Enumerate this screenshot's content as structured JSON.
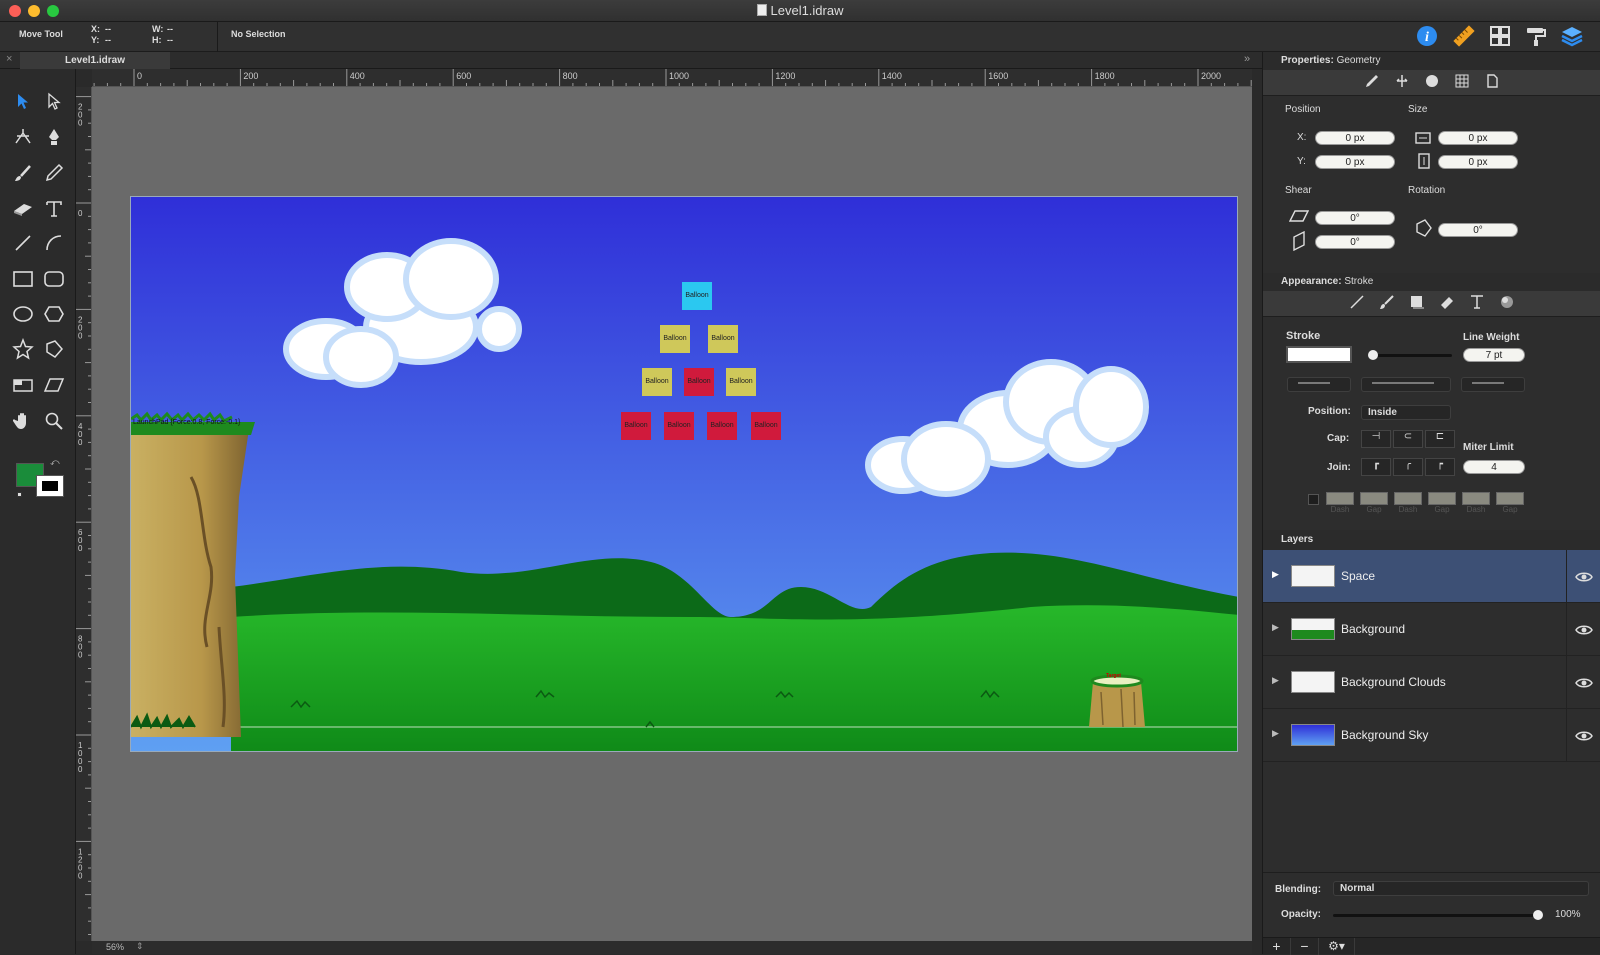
{
  "window": {
    "title": "Level1.idraw"
  },
  "toolbar": {
    "tool_name": "Move Tool",
    "x_label": "X:",
    "x_value": "--",
    "y_label": "Y:",
    "y_value": "--",
    "w_label": "W:",
    "w_value": "--",
    "h_label": "H:",
    "h_value": "--",
    "selection": "No Selection",
    "right_icons": [
      "info-icon",
      "ruler-icon",
      "grid-icon",
      "paint-roller-icon",
      "layers-icon"
    ]
  },
  "tabs": [
    {
      "label": "Level1.idraw"
    }
  ],
  "rulers": {
    "horizontal": [
      "0",
      "200",
      "400",
      "600",
      "800",
      "1000",
      "1200",
      "1400",
      "1600",
      "1800",
      "2000"
    ],
    "vertical": [
      "200",
      "0",
      "200",
      "400",
      "600",
      "800",
      "1000",
      "1200"
    ]
  },
  "canvas": {
    "balloon_label": "Balloon",
    "launch_label": "LaunchPad {Force:0.8, Force:-0.1}",
    "target_label": "Target",
    "colors": {
      "sky_top": "#2f2fd8",
      "sky_bottom": "#5b8ff0",
      "grass": "#1aa61a",
      "hills": "#0e7a1e",
      "cyan_balloon": "#2bc8f0",
      "yellow_balloon": "#cfc85a",
      "red_balloon": "#d01a3c"
    }
  },
  "status": {
    "zoom": "56%"
  },
  "properties": {
    "header_label": "Properties:",
    "header_value": "Geometry",
    "tabs": [
      "pen-icon",
      "anchor-icon",
      "fill-icon",
      "grid-icon",
      "page-icon"
    ],
    "position_label": "Position",
    "size_label": "Size",
    "x_label": "X:",
    "x_value": "0 px",
    "y_label": "Y:",
    "y_value": "0 px",
    "w_value": "0 px",
    "h_value": "0 px",
    "shear_label": "Shear",
    "rotation_label": "Rotation",
    "shear_h": "0°",
    "shear_v": "0°",
    "rotation_value": "0°"
  },
  "appearance": {
    "header_label": "Appearance:",
    "header_value": "Stroke",
    "tabs": [
      "line-icon",
      "brush-icon",
      "shadow-icon",
      "eraser-icon",
      "text-icon",
      "gradient-icon"
    ],
    "stroke_label": "Stroke",
    "line_weight_label": "Line Weight",
    "line_weight_value": "7 pt",
    "position_label": "Position:",
    "position_value": "Inside",
    "cap_label": "Cap:",
    "join_label": "Join:",
    "miter_label": "Miter Limit",
    "miter_value": "4",
    "dash_labels": [
      "Dash",
      "Gap",
      "Dash",
      "Gap",
      "Dash",
      "Gap"
    ]
  },
  "layers": {
    "header": "Layers",
    "items": [
      {
        "name": "Space",
        "selected": true
      },
      {
        "name": "Background",
        "selected": false
      },
      {
        "name": "Background Clouds",
        "selected": false
      },
      {
        "name": "Background Sky",
        "selected": false
      }
    ],
    "blending_label": "Blending:",
    "blending_value": "Normal",
    "opacity_label": "Opacity:",
    "opacity_value": "100%",
    "add_label": "+",
    "remove_label": "−"
  }
}
